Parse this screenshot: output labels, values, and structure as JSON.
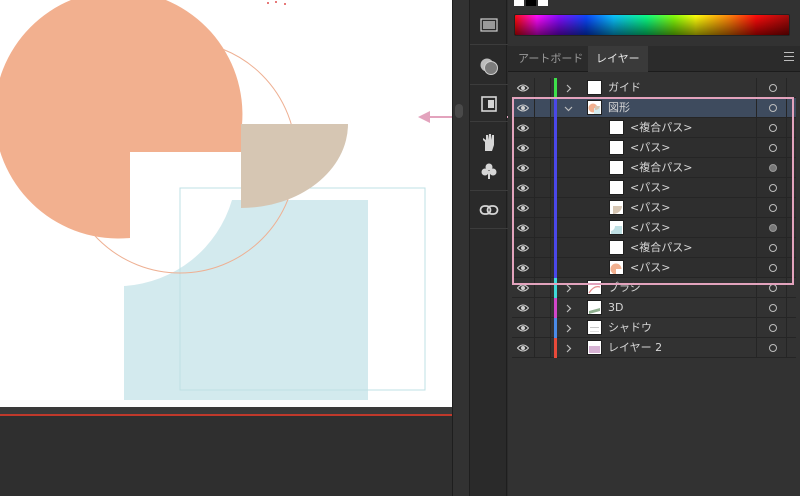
{
  "tabs": [
    {
      "label": "アートボード",
      "active": false
    },
    {
      "label": "レイヤー",
      "active": true
    }
  ],
  "layers": [
    {
      "name": "ガイド",
      "color": "#3ee04a",
      "expanded": false,
      "target_filled": false,
      "sub": false,
      "thumb": "blank"
    },
    {
      "name": "図形",
      "color": "#4a47e8",
      "expanded": true,
      "target_filled": false,
      "sub": false,
      "selected": true,
      "thumb": "shapes"
    },
    {
      "name": "<複合パス>",
      "color": "#4a47e8",
      "sub": true,
      "target_filled": false,
      "thumb": "blank"
    },
    {
      "name": "<パス>",
      "color": "#4a47e8",
      "sub": true,
      "target_filled": false,
      "thumb": "blank"
    },
    {
      "name": "<複合パス>",
      "color": "#4a47e8",
      "sub": true,
      "target_filled": true,
      "thumb": "blank"
    },
    {
      "name": "<パス>",
      "color": "#4a47e8",
      "sub": true,
      "target_filled": false,
      "thumb": "blank"
    },
    {
      "name": "<パス>",
      "color": "#4a47e8",
      "sub": true,
      "target_filled": false,
      "thumb": "tan"
    },
    {
      "name": "<パス>",
      "color": "#4a47e8",
      "sub": true,
      "target_filled": true,
      "thumb": "blue"
    },
    {
      "name": "<複合パス>",
      "color": "#4a47e8",
      "sub": true,
      "target_filled": false,
      "thumb": "blank"
    },
    {
      "name": "<パス>",
      "color": "#4a47e8",
      "sub": true,
      "target_filled": false,
      "thumb": "peach"
    },
    {
      "name": "ブラシ",
      "color": "#3fd9d9",
      "expanded": false,
      "target_filled": false,
      "sub": false,
      "thumb": "brush"
    },
    {
      "name": "3D",
      "color": "#d146c9",
      "expanded": false,
      "target_filled": false,
      "sub": false,
      "thumb": "3d"
    },
    {
      "name": "シャドウ",
      "color": "#4a8be8",
      "expanded": false,
      "target_filled": false,
      "sub": false,
      "thumb": "shadow"
    },
    {
      "name": "レイヤー 2",
      "color": "#e84a3a",
      "expanded": false,
      "target_filled": false,
      "sub": false,
      "thumb": "layer2"
    }
  ],
  "colors": {
    "peach": "#f2b08f",
    "tan": "#d6c6b3",
    "lightblue": "#d3eaee",
    "highlight": "#e3a3bd"
  },
  "tools": [
    "gradient-icon",
    "transparency-icon",
    "artboard-icon",
    "puppet-hand-icon",
    "symbols-club-icon",
    "links-icon"
  ]
}
